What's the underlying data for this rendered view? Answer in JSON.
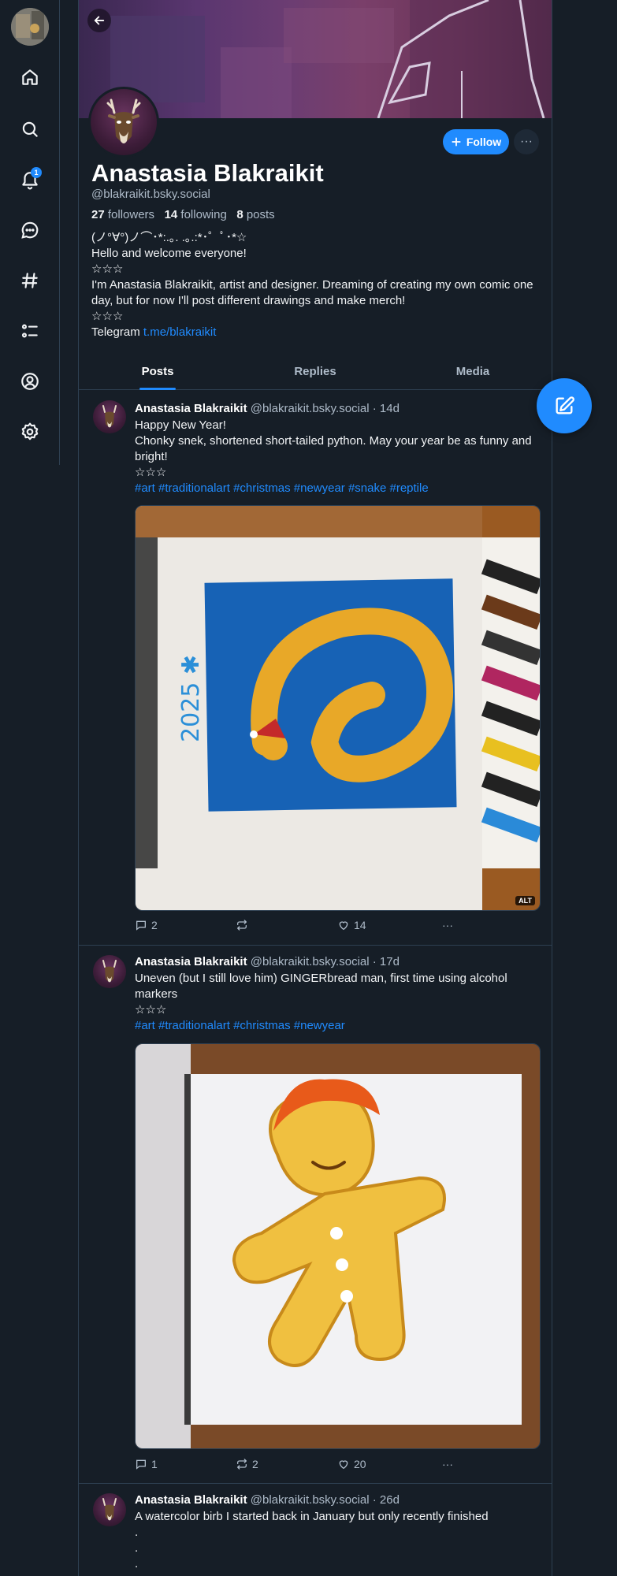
{
  "sidebar": {
    "notif_count": "1"
  },
  "profile": {
    "name": "Anastasia Blakraikit",
    "handle": "@blakraikit.bsky.social",
    "followers_count": "27",
    "followers_label": "followers",
    "following_count": "14",
    "following_label": "following",
    "posts_count": "8",
    "posts_label": "posts",
    "follow_label": "Follow",
    "bio": {
      "line1": "(ノ°∀°)ノ⌒･*:.｡. .｡.:*･゜ﾟ･*☆",
      "line2": "Hello and welcome everyone!",
      "line3": "☆☆☆",
      "line4": "I'm Anastasia Blakraikit, artist and designer. Dreaming of creating my own comic one day, but for now I'll post different drawings and make merch!",
      "line5": "☆☆☆",
      "telegram_label": "Telegram",
      "telegram_link": "t.me/blakraikit"
    }
  },
  "tabs": [
    "Posts",
    "Replies",
    "Media"
  ],
  "posts": [
    {
      "author": "Anastasia Blakraikit",
      "handle": "@blakraikit.bsky.social",
      "time": "· 14d",
      "line1": "Happy New Year!",
      "line2": "Chonky snek, shortened short-tailed python. May your year be as funny and bright!",
      "line3": "☆☆☆",
      "tags": "#art #traditionalart #christmas #newyear #snake #reptile",
      "alt": "ALT",
      "replies": "2",
      "reposts": "",
      "likes": "14"
    },
    {
      "author": "Anastasia Blakraikit",
      "handle": "@blakraikit.bsky.social",
      "time": "· 17d",
      "line1": "Uneven (but I still love him) GINGERbread man, first time using alcohol markers",
      "line2": "☆☆☆",
      "tags": "#art #traditionalart #christmas #newyear",
      "replies": "1",
      "reposts": "2",
      "likes": "20"
    },
    {
      "author": "Anastasia Blakraikit",
      "handle": "@blakraikit.bsky.social",
      "time": "· 26d",
      "line1": "A watercolor birb I started back in January but only recently finished",
      "line2": ".",
      "line3": ".",
      "line4": "."
    }
  ],
  "colors": {
    "background": "#161e27",
    "accent": "#208bfe",
    "border": "#2e4052",
    "muted_text": "#aebbc9"
  }
}
